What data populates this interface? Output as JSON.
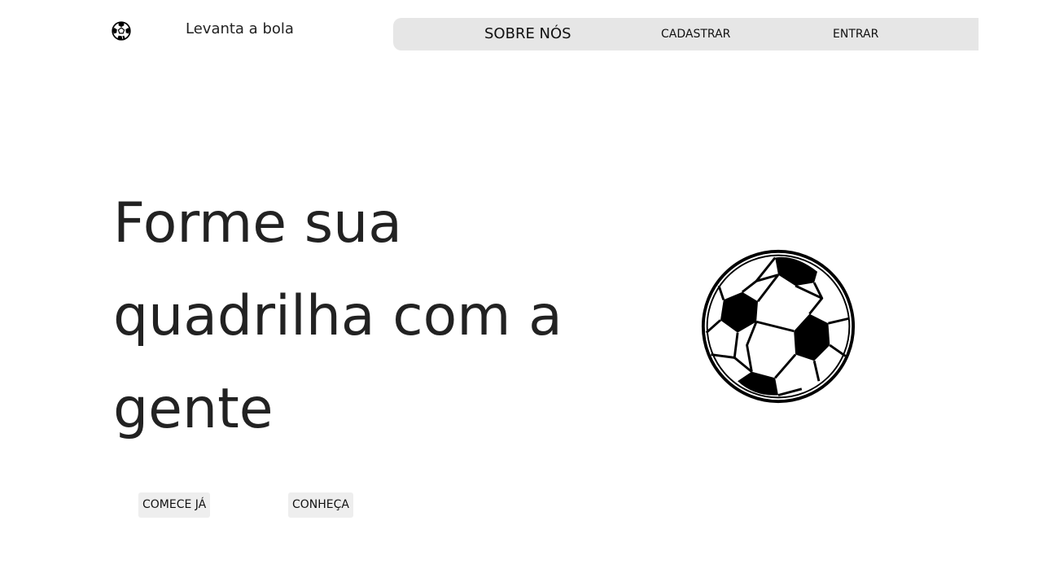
{
  "header": {
    "brand": "Levanta a bola",
    "logo_icon": "soccer-ball-icon"
  },
  "nav": {
    "items": [
      {
        "label": "SOBRE NÓS"
      },
      {
        "label": "CADASTRAR"
      },
      {
        "label": "ENTRAR"
      }
    ]
  },
  "hero": {
    "title": "Forme sua quadrilha com a gente",
    "buttons": [
      {
        "label": "COMECE JÁ"
      },
      {
        "label": "CONHEÇA"
      }
    ],
    "image_icon": "soccer-ball-icon"
  },
  "colors": {
    "nav_background": "#e6e6e6",
    "button_background": "#eeeeee",
    "text": "#222222"
  }
}
